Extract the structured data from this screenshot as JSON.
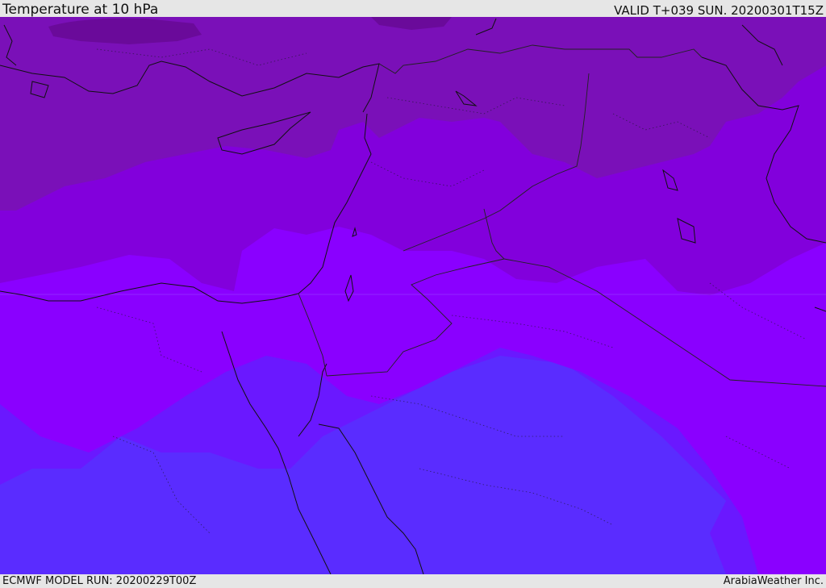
{
  "header": {
    "title": "Temperature at 10 hPa",
    "valid_time": "VALID T+039 SUN. 20200301T15Z"
  },
  "footer": {
    "model_run": "ECMWF MODEL RUN: 20200229T00Z",
    "credit": "ArabiaWeather Inc."
  },
  "map": {
    "field": "temperature",
    "level": "10 hPa",
    "colors": {
      "coldest_band": "#6a0a9a",
      "cold_band": "#7a10b8",
      "mid_band": "#8200dc",
      "warm_band": "#8a00ff",
      "warmer_band": "#6a18ff",
      "warmest_band": "#5a2cff",
      "coastline": "#111111",
      "border": "#222222"
    }
  }
}
